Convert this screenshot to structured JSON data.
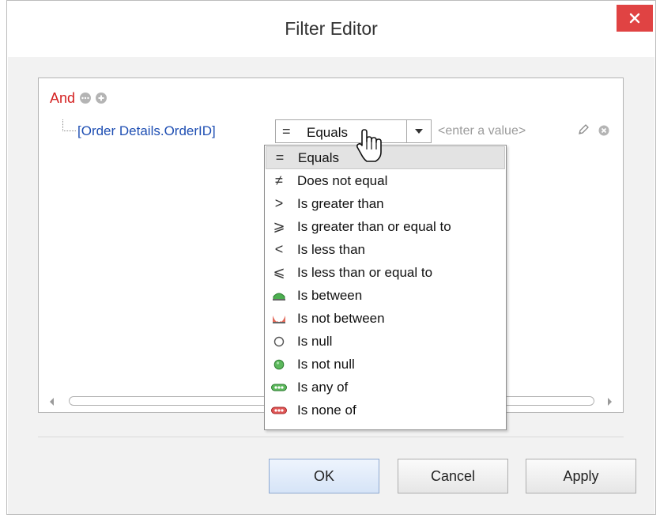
{
  "window": {
    "title": "Filter Editor"
  },
  "filter": {
    "group_operator": "And",
    "condition": {
      "field": "[Order Details.OrderID]",
      "operator": "Equals",
      "value_placeholder": "<enter a value>"
    }
  },
  "operators": [
    {
      "label": "Equals",
      "symbol": "=",
      "icon": "equals-icon",
      "selected": true
    },
    {
      "label": "Does not equal",
      "symbol": "≠",
      "icon": "not-equal-icon"
    },
    {
      "label": "Is greater than",
      "symbol": ">",
      "icon": "greater-than-icon"
    },
    {
      "label": "Is greater than or equal to",
      "symbol": "⩾",
      "icon": "greater-equal-icon"
    },
    {
      "label": "Is less than",
      "symbol": "<",
      "icon": "less-than-icon"
    },
    {
      "label": "Is less than or equal to",
      "symbol": "⩽",
      "icon": "less-equal-icon"
    },
    {
      "label": "Is between",
      "symbol": "",
      "icon": "between-icon"
    },
    {
      "label": "Is not between",
      "symbol": "",
      "icon": "not-between-icon"
    },
    {
      "label": "Is null",
      "symbol": "",
      "icon": "null-icon"
    },
    {
      "label": "Is not null",
      "symbol": "",
      "icon": "not-null-icon"
    },
    {
      "label": "Is any of",
      "symbol": "",
      "icon": "any-of-icon"
    },
    {
      "label": "Is none of",
      "symbol": "",
      "icon": "none-of-icon"
    }
  ],
  "buttons": {
    "ok": "OK",
    "cancel": "Cancel",
    "apply": "Apply"
  },
  "colors": {
    "close_button": "#e04343",
    "group_operator": "#d42020",
    "field_name": "#1f4fb3",
    "placeholder": "#9b9b9b"
  }
}
